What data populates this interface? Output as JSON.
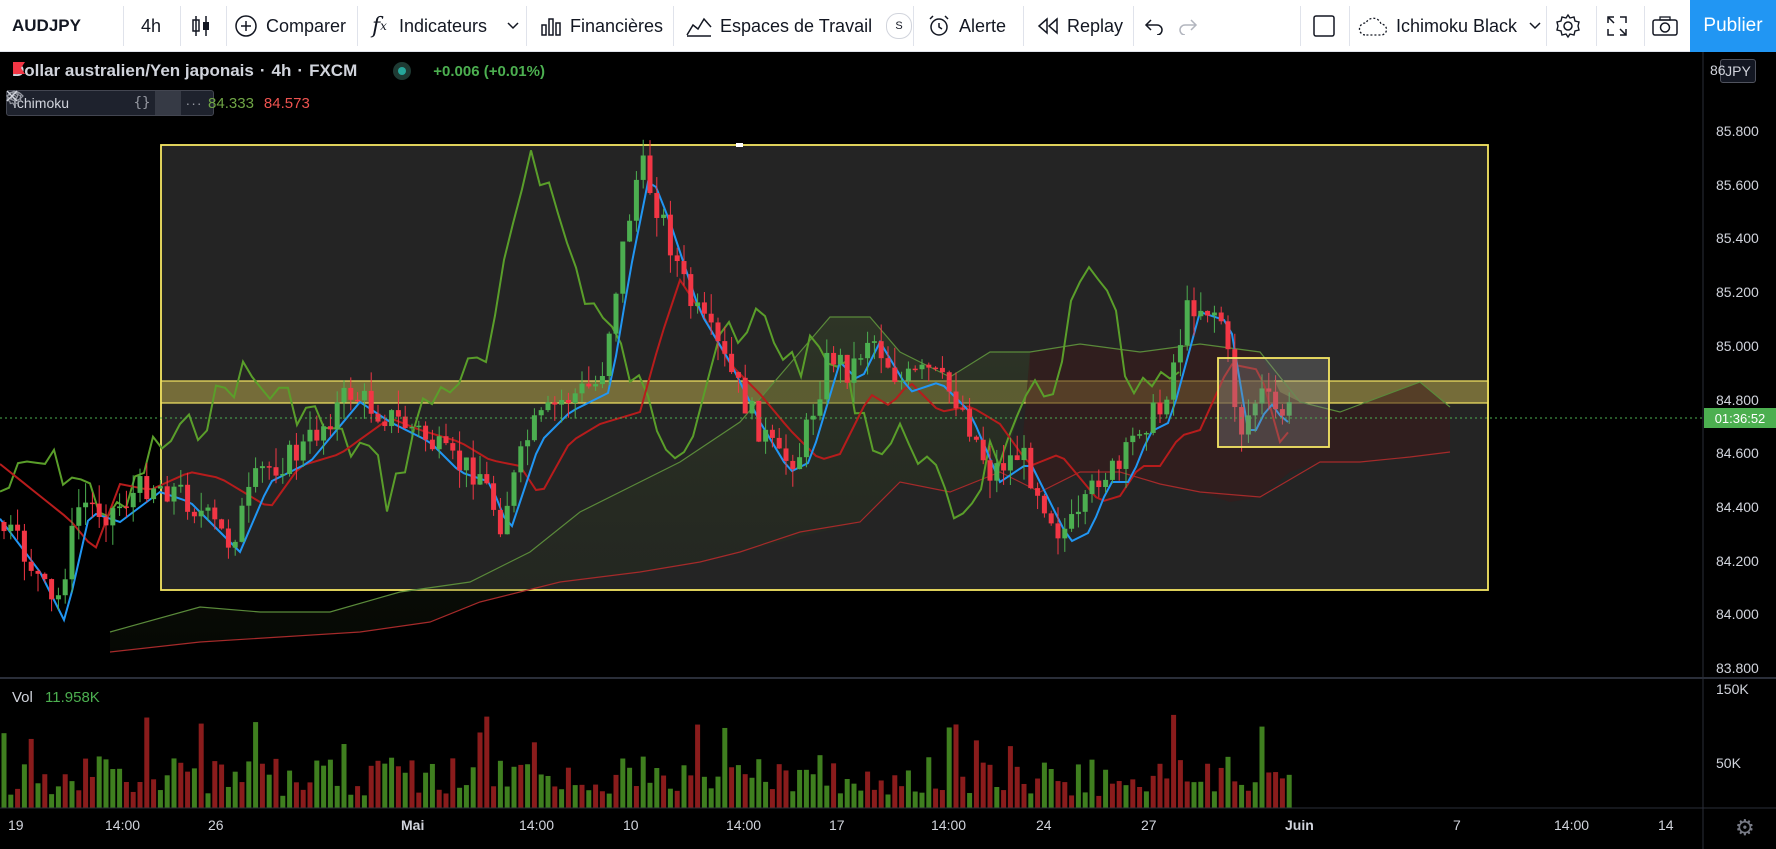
{
  "toolbar": {
    "symbol": "AUDJPY",
    "interval": "4h",
    "compare": "Comparer",
    "indicators": "Indicateurs",
    "financials": "Financières",
    "workspaces": "Espaces de Travail",
    "workspaces_badge": "S",
    "alert": "Alerte",
    "replay": "Replay",
    "layout_name": "Ichimoku Black",
    "publish": "Publier"
  },
  "legend": {
    "title": "Dollar australien/Yen japonais",
    "interval": "4h",
    "exchange": "FXCM",
    "change": "+0.006 (+0.01%)"
  },
  "indicator": {
    "name": "Ichimoku",
    "value1": "84.333",
    "value2": "84.573"
  },
  "volume": {
    "label": "Vol",
    "value": "11.958K"
  },
  "price_axis": {
    "currency": "JPY",
    "current_label": "01:36:52",
    "top_partial": "86",
    "labels": [
      "85.800",
      "85.600",
      "85.400",
      "85.200",
      "85.000",
      "84.800",
      "84.600",
      "84.400",
      "84.200",
      "84.000",
      "83.800"
    ],
    "volume_labels": [
      "150K",
      "50K"
    ]
  },
  "time_axis": {
    "labels": [
      "19",
      "14:00",
      "26",
      "Mai",
      "14:00",
      "10",
      "14:00",
      "17",
      "14:00",
      "24",
      "27",
      "Juin",
      "7",
      "14:00",
      "14"
    ]
  },
  "colors": {
    "bull": "#4caf50",
    "bear": "#f23645",
    "conversion": "#2196f3",
    "base": "#b71c1c",
    "lagging": "#5a9e2a",
    "zone_border": "#f5e663",
    "background": "#000000"
  }
}
